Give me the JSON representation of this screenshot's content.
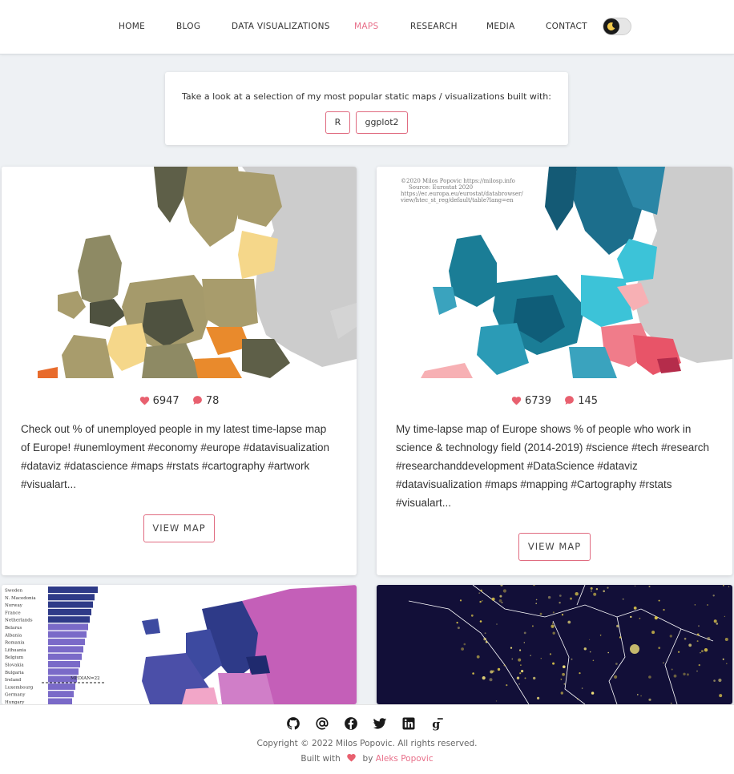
{
  "nav": {
    "items": [
      "HOME",
      "BLOG",
      "DATA VISUALIZATIONS",
      "MAPS",
      "RESEARCH",
      "MEDIA",
      "CONTACT"
    ],
    "active": "MAPS",
    "accent": "#e8708a"
  },
  "intro": {
    "text": "Take a look at a selection of my most popular static maps / visualizations built with:",
    "tags": [
      "R",
      "ggplot2"
    ]
  },
  "cards": [
    {
      "likes": "6947",
      "comments": "78",
      "description": "Check out % of unemployed people in my latest time-lapse map of Europe! #unemloyment #economy #europe #datavisualization #dataviz #datascience #maps #rstats #cartography #artwork #visualart...",
      "button": "VIEW MAP"
    },
    {
      "likes": "6739",
      "comments": "145",
      "description": "My time-lapse map of Europe shows % of people who work in science & technology field (2014-2019) #science #tech #research #researchanddevelopment #DataScience #dataviz #datavisualization #maps #mapping #Cartography #rstats #visualart...",
      "button": "VIEW MAP",
      "image_caption": "©2020 Milos Popovic https://milosp.info  Source: Eurostat 2020  https://ec.europa.eu/eurostat/databrowser/view/htec_st_reg/default/table?lang=en"
    },
    {
      "chart_labels": [
        "Sweden",
        "N. Macedonia",
        "Norway",
        "France",
        "Netherlands",
        "Belarus",
        "Albania",
        "Romania",
        "Lithuania",
        "Belgium",
        "Slovakia",
        "Bulgaria",
        "Ireland",
        "Luxembourg",
        "Germany",
        "Hungary"
      ],
      "median_label": "MEDIAN=22"
    },
    {}
  ],
  "footer": {
    "icons": [
      "github-icon",
      "at-icon",
      "facebook-icon",
      "twitter-icon",
      "linkedin-icon",
      "google-scholar-icon"
    ],
    "copyright": "Copyright © 2022 Milos Popovic. All rights reserved.",
    "built_with": "Built with",
    "by": "by",
    "author": "Aleks Popovic"
  }
}
